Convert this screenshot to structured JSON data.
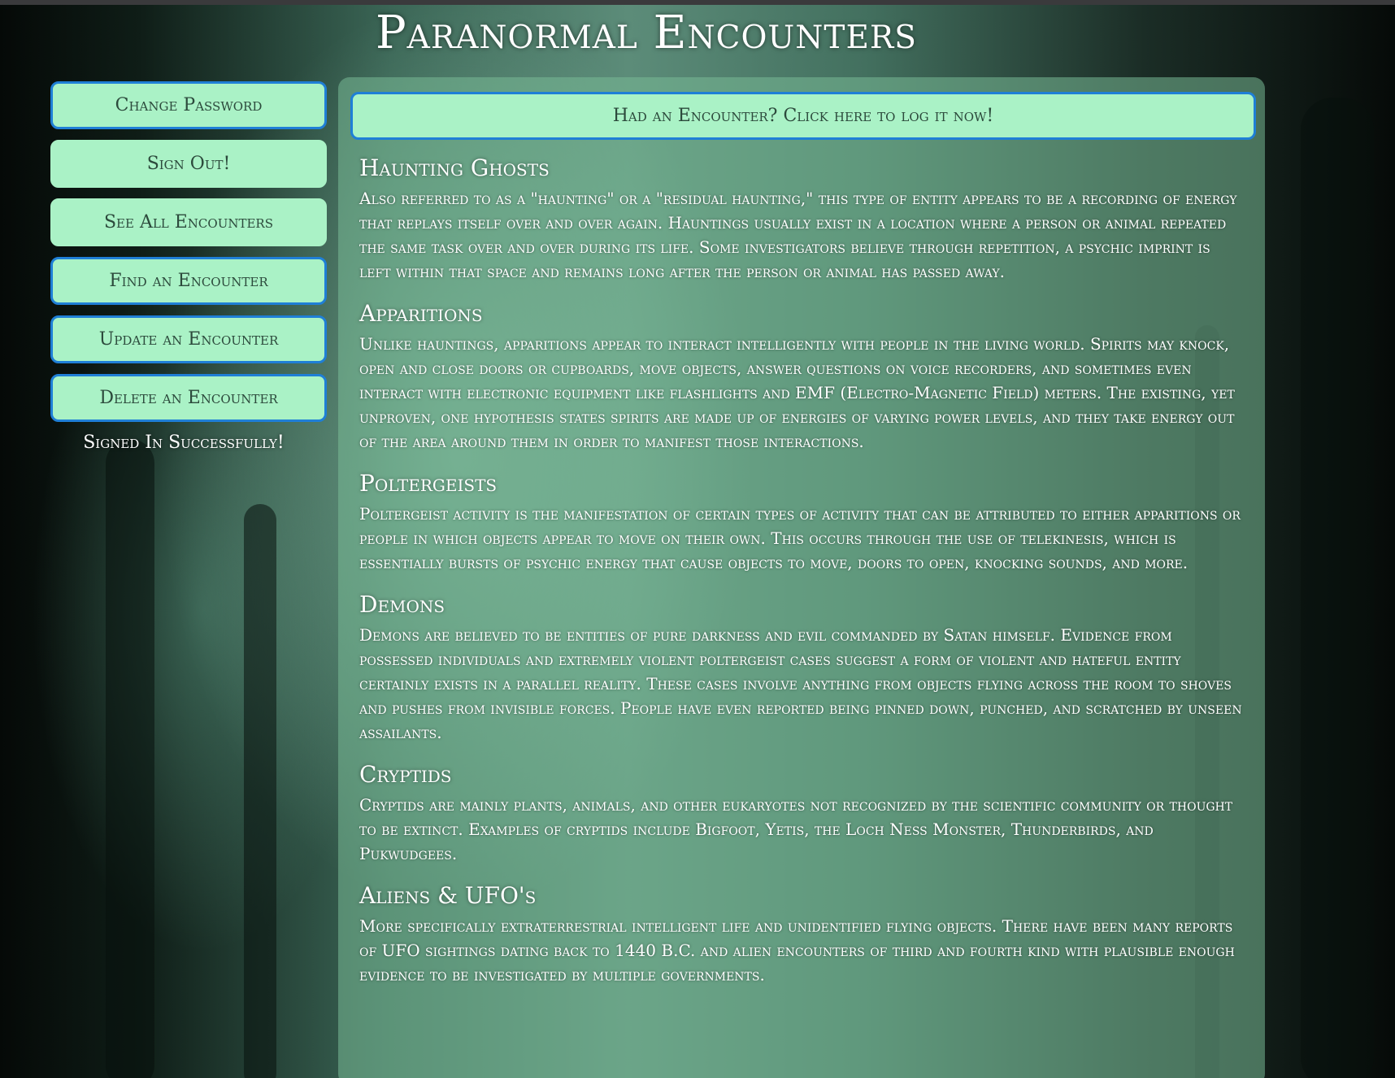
{
  "site": {
    "title": "Paranormal Encounters"
  },
  "sidebar": {
    "buttons": [
      {
        "label": "Change Password"
      },
      {
        "label": "Sign Out!"
      },
      {
        "label": "See All Encounters"
      },
      {
        "label": "Find an Encounter"
      },
      {
        "label": "Update an Encounter"
      },
      {
        "label": "Delete an Encounter"
      }
    ],
    "status_message": "Signed In Successfully!"
  },
  "main": {
    "log_button_label": "Had an Encounter? Click here to log it now!",
    "sections": [
      {
        "heading": "Haunting Ghosts",
        "body": "Also referred to as a \"haunting\" or a \"residual haunting,\" this type of entity appears to be a recording of energy that replays itself over and over again. Hauntings usually exist in a location where a person or animal repeated the same task over and over during its life. Some investigators believe through repetition, a psychic imprint is left within that space and remains long after the person or animal has passed away."
      },
      {
        "heading": "Apparitions",
        "body": "Unlike hauntings, apparitions appear to interact intelligently with people in the living world. Spirits may knock, open and close doors or cupboards, move objects, answer questions on voice recorders, and sometimes even interact with electronic equipment like flashlights and EMF (Electro-Magnetic Field) meters. The existing, yet unproven, one hypothesis states spirits are made up of energies of varying power levels, and they take energy out of the area around them in order to manifest those interactions."
      },
      {
        "heading": "Poltergeists",
        "body": "Poltergeist activity is the manifestation of certain types of activity that can be attributed to either apparitions or people in which objects appear to move on their own. This occurs through the use of telekinesis, which is essentially bursts of psychic energy that cause objects to move, doors to open, knocking sounds, and more."
      },
      {
        "heading": "Demons",
        "body": "Demons are believed to be entities of pure darkness and evil commanded by Satan himself. Evidence from possessed individuals and extremely violent poltergeist cases suggest a form of violent and hateful entity certainly exists in a parallel reality. These cases involve anything from objects flying across the room to shoves and pushes from invisible forces. People have even reported being pinned down, punched, and scratched by unseen assailants."
      },
      {
        "heading": "Cryptids",
        "body": "Cryptids are mainly plants, animals, and other eukaryotes not recognized by the scientific community or thought to be extinct. Examples of cryptids include Bigfoot, Yetis, the Loch Ness Monster, Thunderbirds, and Pukwudgees."
      },
      {
        "heading": "Aliens & UFO's",
        "body": "More specifically extraterrestrial intelligent life and unidentified flying objects. There have been many reports of UFO sightings dating back to 1440 B.C. and alien encounters of third and fourth kind with plausible enough evidence to be investigated by multiple governments."
      }
    ]
  }
}
